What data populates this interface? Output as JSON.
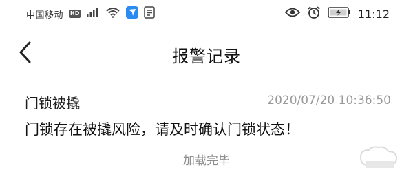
{
  "status_bar": {
    "carrier": "中国移动",
    "network_badge": "HD",
    "time": "11:12",
    "icons": [
      "signal-icon",
      "wifi-icon",
      "app-notification-icon",
      "message-icon",
      "eye-icon",
      "alarm-icon",
      "battery-charging-icon"
    ]
  },
  "nav": {
    "title": "报警记录",
    "back_icon": "chevron-left-icon"
  },
  "records": [
    {
      "title": "门锁被撬",
      "time": "2020/07/20 10:36:50",
      "message": "门锁存在被撬风险，请及时确认门锁状态！"
    }
  ],
  "footer": {
    "load_status": "加载完毕"
  },
  "colors": {
    "background": "#ffffff",
    "primary_text": "#111111",
    "secondary_text": "#9a9a9a",
    "app_icon_blue": "#2a8cf0"
  }
}
